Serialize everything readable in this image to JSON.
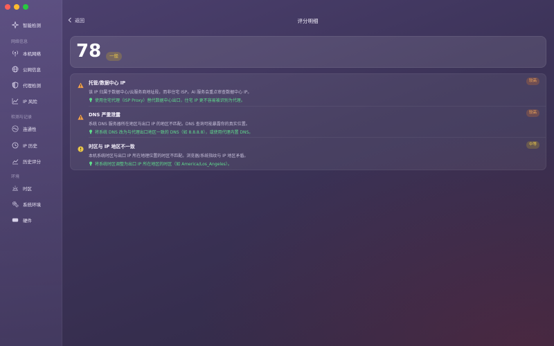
{
  "sidebar": {
    "items": [
      {
        "label": "智能检测",
        "icon": "sparkle-icon"
      },
      {
        "label": "本机网络",
        "icon": "antenna-icon"
      },
      {
        "label": "公网信息",
        "icon": "globe-icon"
      },
      {
        "label": "代理检测",
        "icon": "shield-icon"
      },
      {
        "label": "IP 风险",
        "icon": "chart-line-icon"
      },
      {
        "label": "连通性",
        "icon": "wave-icon"
      },
      {
        "label": "IP 历史",
        "icon": "clock-icon"
      },
      {
        "label": "历史评分",
        "icon": "trend-icon"
      },
      {
        "label": "时区",
        "icon": "sunrise-icon"
      },
      {
        "label": "系统环境",
        "icon": "gears-icon"
      },
      {
        "label": "硬件",
        "icon": "hardware-icon"
      }
    ],
    "sections": [
      "网络信息",
      "检测与记录",
      "环境"
    ]
  },
  "header": {
    "back_label": "返回",
    "title": "评分明细"
  },
  "score": {
    "value": "78",
    "level": "一般"
  },
  "issues": [
    {
      "title": "托管/数据中心 IP",
      "description": "该 IP 归属于数据中心/云服务商地址段，而非住宅 ISP。AI 服务会重点审查数据中心 IP。",
      "suggestion": "使用住宅代理（ISP Proxy）替代数据中心出口，住宅 IP 更不容易被识别为代理。",
      "severity": "较高",
      "icon": "warning-triangle-icon"
    },
    {
      "title": "DNS 严重泄露",
      "description": "系统 DNS 服务器所在地区与出口 IP 的地区不匹配。DNS 查询可能暴露你的真实位置。",
      "suggestion": "将系统 DNS 改为与代理出口地区一致的 DNS（如 8.8.8.8），或使用代理内置 DNS。",
      "severity": "较高",
      "icon": "warning-triangle-icon"
    },
    {
      "title": "时区与 IP 地区不一致",
      "description": "本机系统时区与出口 IP 所在地理位置的时区不匹配。浏览器/系统指纹与 IP 地区矛盾。",
      "suggestion": "将系统时区调整为出口 IP 所在地区的时区（如 America/Los_Angeles）。",
      "severity": "中等",
      "icon": "info-circle-icon"
    }
  ],
  "colors": {
    "severity_high": "#f0a55a",
    "severity_mid": "#e8c64a",
    "suggestion": "#5fdc8c",
    "warning": "#f0a04b",
    "info": "#e8c64a"
  }
}
